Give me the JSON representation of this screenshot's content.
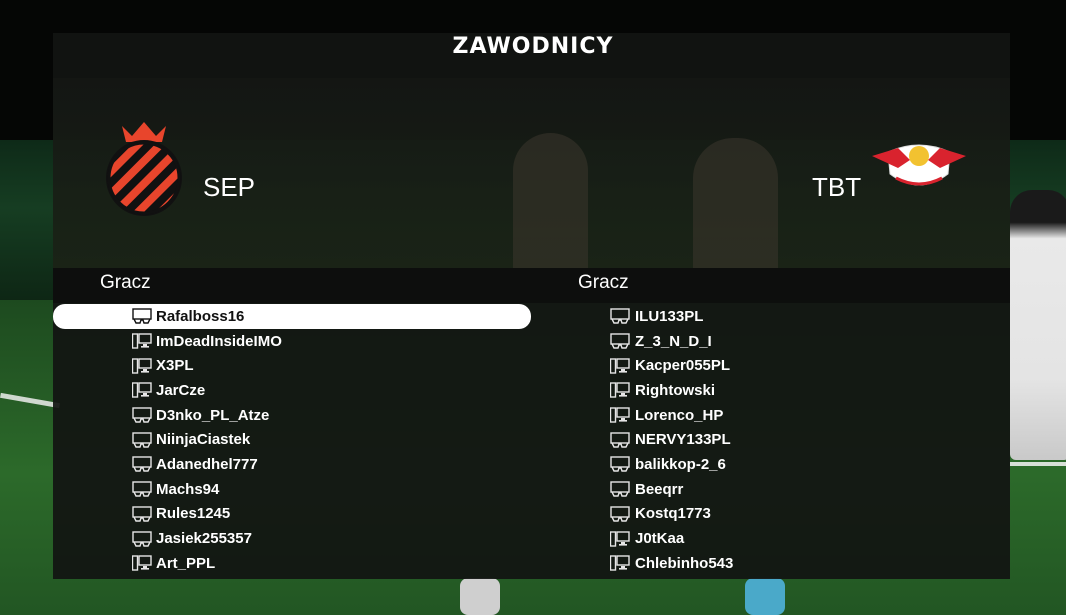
{
  "screen": {
    "title": "ZAWODNICY"
  },
  "teams": {
    "home": {
      "name": "SEP",
      "badge_colors": {
        "accent": "#e8452c",
        "dark": "#111111"
      }
    },
    "away": {
      "name": "TBT",
      "badge_colors": {
        "accent": "#d9232e",
        "light": "#ffffff"
      }
    }
  },
  "columns": {
    "home_header": "Gracz",
    "away_header": "Gracz"
  },
  "home_players": [
    {
      "name": "Rafalboss16",
      "device": "console-icon",
      "selected": true
    },
    {
      "name": "ImDeadInsideIMO",
      "device": "pc-icon"
    },
    {
      "name": "X3PL",
      "device": "pc-icon"
    },
    {
      "name": "JarCze",
      "device": "pc-icon"
    },
    {
      "name": "D3nko_PL_Atze",
      "device": "console-icon"
    },
    {
      "name": "NiinjaCiastek",
      "device": "console-icon"
    },
    {
      "name": "Adanedhel777",
      "device": "console-icon"
    },
    {
      "name": "Machs94",
      "device": "console-icon"
    },
    {
      "name": "Rules1245",
      "device": "console-icon"
    },
    {
      "name": "Jasiek255357",
      "device": "console-icon"
    },
    {
      "name": "Art_PPL",
      "device": "pc-icon"
    }
  ],
  "away_players": [
    {
      "name": "ILU133PL",
      "device": "console-icon"
    },
    {
      "name": "Z_3_N_D_I",
      "device": "console-icon"
    },
    {
      "name": "Kacper055PL",
      "device": "pc-icon"
    },
    {
      "name": "Rightowski",
      "device": "pc-icon"
    },
    {
      "name": "Lorenco_HP",
      "device": "pc-icon"
    },
    {
      "name": "NERVY133PL",
      "device": "console-icon"
    },
    {
      "name": "balikkop-2_6",
      "device": "console-icon"
    },
    {
      "name": "Beeqrr",
      "device": "console-icon"
    },
    {
      "name": "Kostq1773",
      "device": "console-icon"
    },
    {
      "name": "J0tKaa",
      "device": "pc-icon"
    },
    {
      "name": "Chlebinho543",
      "device": "pc-icon"
    }
  ]
}
